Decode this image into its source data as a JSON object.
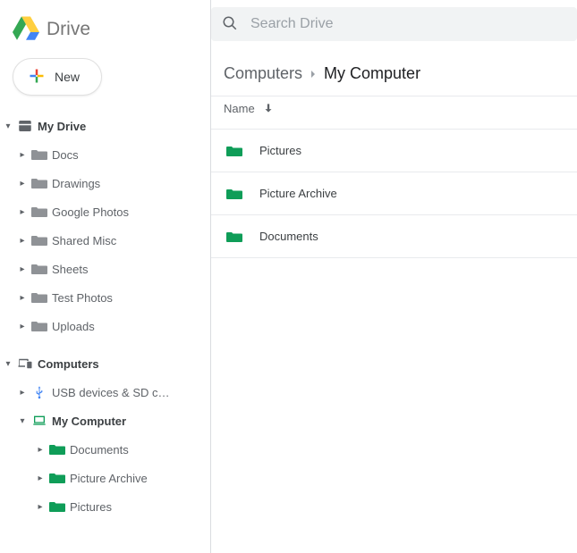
{
  "header": {
    "app_name": "Drive",
    "search_placeholder": "Search Drive",
    "new_label": "New"
  },
  "breadcrumb": {
    "parent": "Computers",
    "current": "My Computer"
  },
  "list": {
    "column_name": "Name",
    "sort_desc": true,
    "items": [
      {
        "name": "Pictures"
      },
      {
        "name": "Picture Archive"
      },
      {
        "name": "Documents"
      }
    ]
  },
  "sidebar": {
    "my_drive_label": "My Drive",
    "my_drive_children": [
      {
        "label": "Docs"
      },
      {
        "label": "Drawings"
      },
      {
        "label": "Google Photos"
      },
      {
        "label": "Shared Misc"
      },
      {
        "label": "Sheets"
      },
      {
        "label": "Test Photos"
      },
      {
        "label": "Uploads"
      }
    ],
    "computers_label": "Computers",
    "usb_label": "USB devices & SD c…",
    "my_computer_label": "My Computer",
    "my_computer_children": [
      {
        "label": "Documents"
      },
      {
        "label": "Picture Archive"
      },
      {
        "label": "Pictures"
      }
    ]
  }
}
